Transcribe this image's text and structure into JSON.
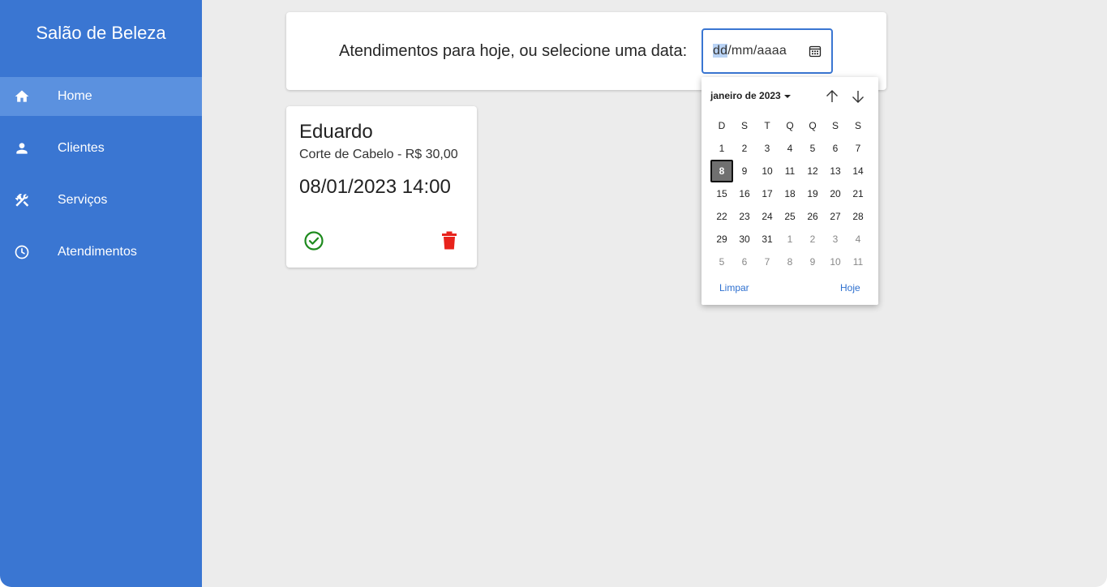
{
  "sidebar": {
    "title": "Salão de Beleza",
    "items": [
      {
        "label": "Home",
        "icon": "home-icon",
        "active": true
      },
      {
        "label": "Clientes",
        "icon": "person-icon",
        "active": false
      },
      {
        "label": "Serviços",
        "icon": "tools-icon",
        "active": false
      },
      {
        "label": "Atendimentos",
        "icon": "clock-icon",
        "active": false
      }
    ]
  },
  "header": {
    "prompt": "Atendimentos para hoje, ou selecione uma data:",
    "date_input": {
      "dd": "dd",
      "rest": "/mm/aaaa",
      "icon": "calendar-icon"
    }
  },
  "appointment": {
    "client": "Eduardo",
    "service": "Corte de Cabelo - R$ 30,00",
    "datetime": "08/01/2023 14:00",
    "confirm_icon": "check-circle-icon",
    "delete_icon": "trash-icon",
    "colors": {
      "confirm": "#1e8a1e",
      "delete": "#e8231c"
    }
  },
  "datepicker": {
    "month_label": "janeiro de 2023",
    "weekdays": [
      "D",
      "S",
      "T",
      "Q",
      "Q",
      "S",
      "S"
    ],
    "weeks": [
      [
        "1",
        "2",
        "3",
        "4",
        "5",
        "6",
        "7"
      ],
      [
        "8",
        "9",
        "10",
        "11",
        "12",
        "13",
        "14"
      ],
      [
        "15",
        "16",
        "17",
        "18",
        "19",
        "20",
        "21"
      ],
      [
        "22",
        "23",
        "24",
        "25",
        "26",
        "27",
        "28"
      ],
      [
        "29",
        "30",
        "31",
        "1",
        "2",
        "3",
        "4"
      ],
      [
        "5",
        "6",
        "7",
        "8",
        "9",
        "10",
        "11"
      ]
    ],
    "selected_day": "8",
    "clear_label": "Limpar",
    "today_label": "Hoje"
  },
  "colors": {
    "sidebar": "#3a76d2",
    "sidebar_active": "#5b91df",
    "background": "#ececec"
  }
}
